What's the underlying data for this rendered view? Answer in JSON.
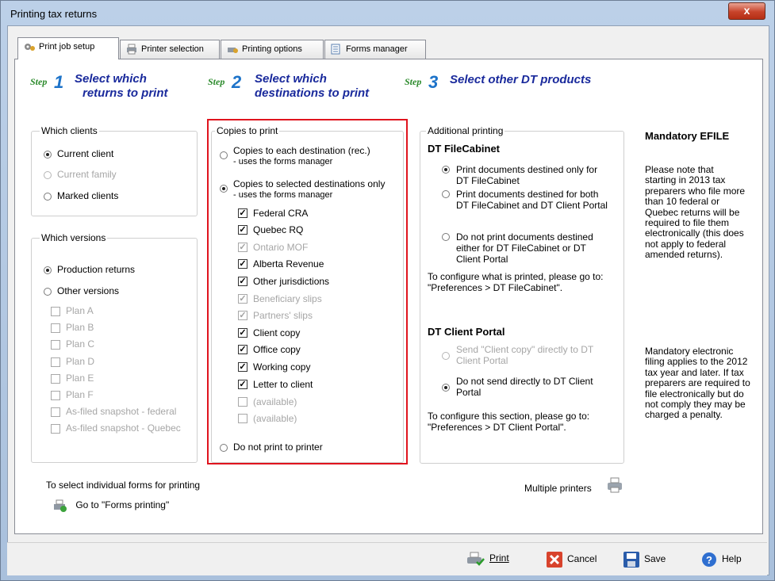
{
  "window": {
    "title": "Printing tax returns",
    "close_label": "x"
  },
  "tabs": [
    {
      "label": "Print job setup",
      "icon": "gear-icon"
    },
    {
      "label": "Printer selection",
      "icon": "printer-icon"
    },
    {
      "label": "Printing options",
      "icon": "options-icon"
    },
    {
      "label": "Forms manager",
      "icon": "forms-icon"
    }
  ],
  "steps": [
    {
      "badge": "Step 1",
      "line1": "Select which",
      "line2": "returns to print"
    },
    {
      "badge": "Step 2",
      "line1": "Select which",
      "line2": "destinations to print"
    },
    {
      "badge": "Step 3",
      "line1": "Select other DT products",
      "line2": ""
    }
  ],
  "which_clients": {
    "legend": "Which clients",
    "options": [
      "Current client",
      "Current family",
      "Marked clients"
    ]
  },
  "which_versions": {
    "legend": "Which versions",
    "options": [
      "Production returns",
      "Other versions"
    ],
    "plans": [
      "Plan A",
      "Plan B",
      "Plan C",
      "Plan D",
      "Plan E",
      "Plan F",
      "As-filed snapshot - federal",
      "As-filed snapshot - Quebec"
    ]
  },
  "copies": {
    "legend": "Copies to print",
    "opt1_line1": "Copies to each destination (rec.)",
    "opt1_line2": "- uses the forms manager",
    "opt2_line1": "Copies to selected destinations only",
    "opt2_line2": "- uses the forms manager",
    "destinations": [
      "Federal CRA",
      "Quebec RQ",
      "Ontario MOF",
      "Alberta Revenue",
      "Other jurisdictions",
      "Beneficiary slips",
      "Partners' slips",
      "Client copy",
      "Office copy",
      "Working copy",
      "Letter to client",
      "(available)",
      "(available)"
    ],
    "opt3": "Do not print to printer"
  },
  "additional": {
    "legend": "Additional printing",
    "filecabinet_title": "DT FileCabinet",
    "fc_opt1": [
      "Print documents destined only for",
      "DT FileCabinet"
    ],
    "fc_opt2": [
      "Print documents destined for both",
      "DT FileCabinet and DT Client Portal"
    ],
    "fc_opt3": [
      "Do not print documents destined",
      "either for DT FileCabinet or DT",
      "Client Portal"
    ],
    "fc_note": [
      "To configure what is printed, please go to:",
      "\"Preferences > DT FileCabinet\"."
    ],
    "portal_title": "DT Client Portal",
    "cp_opt1": [
      "Send \"Client copy\" directly to DT",
      "Client Portal"
    ],
    "cp_opt2": [
      "Do not send directly to DT Client",
      "Portal"
    ],
    "cp_note": [
      "To configure this section, please go to:",
      "\"Preferences > DT Client Portal\"."
    ]
  },
  "efile": {
    "title": "Mandatory EFILE",
    "p1": [
      "Please note that",
      "starting in 2013 tax",
      "preparers who file more",
      "than 10 federal or",
      "Quebec returns will be",
      "required to file them",
      "electronically (this does",
      "not apply to federal",
      "amended returns)."
    ],
    "p2": [
      "Mandatory electronic",
      "filing applies to the 2012",
      "tax year and later. If tax",
      "preparers are required to",
      "file electronically but do",
      "not comply they may be",
      "charged a penalty."
    ]
  },
  "footer": {
    "forms_hint": "To select individual forms for printing",
    "forms_link": "Go to \"Forms printing\"",
    "multiple_printers": "Multiple printers"
  },
  "buttons": {
    "print": "Print",
    "cancel": "Cancel",
    "save": "Save",
    "help": "Help"
  }
}
